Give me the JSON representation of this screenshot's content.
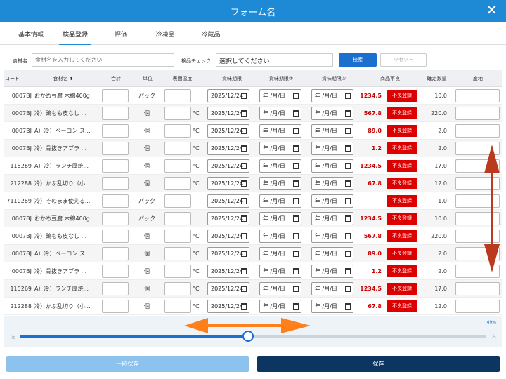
{
  "window": {
    "title": "フォーム名",
    "close": "✕"
  },
  "tabs": [
    {
      "label": "基本情報",
      "active": false
    },
    {
      "label": "検品登録",
      "active": true
    },
    {
      "label": "評価",
      "active": false
    },
    {
      "label": "冷凍品",
      "active": false
    },
    {
      "label": "冷蔵品",
      "active": false
    }
  ],
  "filter": {
    "name_label": "食材名",
    "name_placeholder": "食材名を入力してください",
    "check_label": "検品チェック",
    "check_value": "選択してください",
    "search_button": "検索",
    "reset_button": "リセット"
  },
  "table": {
    "headers": [
      "コード",
      "食材名 ⬍",
      "合計",
      "単位",
      "表面温度",
      "賞味期限",
      "賞味期限②",
      "賞味期限③",
      "商品不良",
      "確定数量",
      "産地"
    ],
    "celsius": "°C",
    "date_empty": "年 /月/日",
    "bad_button": "不良登録",
    "rows": [
      {
        "code": "0007BJ",
        "name": "おかめ豆腐 木綿400g",
        "unit": "パック",
        "temp": false,
        "date": "2025/12/24",
        "price": "1234.5",
        "qty": "10.0"
      },
      {
        "code": "0007BJ",
        "name": "冷）鶏もも皮なし ...",
        "unit": "個",
        "temp": true,
        "date": "2025/12/24",
        "price": "567.8",
        "qty": "220.0"
      },
      {
        "code": "0007BJ",
        "name": "A）冷）ベーコン ス...",
        "unit": "個",
        "temp": true,
        "date": "2025/12/24",
        "price": "89.0",
        "qty": "2.0"
      },
      {
        "code": "0007BJ",
        "name": "冷）骨抜きアブラ ...",
        "unit": "個",
        "temp": true,
        "date": "2025/12/24",
        "price": "1.2",
        "qty": "2.0"
      },
      {
        "code": "115269",
        "name": "A）冷）ランチ厚焼...",
        "unit": "個",
        "temp": true,
        "date": "2025/12/24",
        "price": "1234.5",
        "qty": "17.0"
      },
      {
        "code": "212288",
        "name": "冷）かぶ乱切り（小...",
        "unit": "個",
        "temp": true,
        "date": "2025/12/24",
        "price": "67.8",
        "qty": "12.0"
      },
      {
        "code": "7110269",
        "name": "冷）そのまま使える...",
        "unit": "パック",
        "temp": false,
        "date": "2025/12/24",
        "price": "",
        "qty": "1.0"
      },
      {
        "code": "0007BJ",
        "name": "おかめ豆腐 木綿400g",
        "unit": "パック",
        "temp": false,
        "date": "2025/12/24",
        "price": "1234.5",
        "qty": "10.0"
      },
      {
        "code": "0007BJ",
        "name": "冷）鶏もも皮なし ...",
        "unit": "個",
        "temp": true,
        "date": "2025/12/24",
        "price": "567.8",
        "qty": "220.0"
      },
      {
        "code": "0007BJ",
        "name": "A）冷）ベーコン ス...",
        "unit": "個",
        "temp": true,
        "date": "2025/12/24",
        "price": "89.0",
        "qty": "2.0"
      },
      {
        "code": "0007BJ",
        "name": "冷）骨抜きアブラ ...",
        "unit": "個",
        "temp": true,
        "date": "2025/12/24",
        "price": "1.2",
        "qty": "2.0"
      },
      {
        "code": "115269",
        "name": "A）冷）ランチ厚焼...",
        "unit": "個",
        "temp": true,
        "date": "2025/12/24",
        "price": "1234.5",
        "qty": "17.0"
      },
      {
        "code": "212288",
        "name": "冷）かぶ乱切り（小...",
        "unit": "個",
        "temp": true,
        "date": "2025/12/24",
        "price": "67.8",
        "qty": "12.0"
      }
    ]
  },
  "slider": {
    "percent_label": "49%",
    "value": 0.49,
    "min_label": "左",
    "max_label": "右"
  },
  "footer": {
    "temp_save": "一時保存",
    "save": "保存"
  },
  "colors": {
    "accent": "#1e8ad6",
    "danger": "#dd0000",
    "annotation": "#ff7f1a",
    "vertical_annotation": "#b93a1c"
  }
}
